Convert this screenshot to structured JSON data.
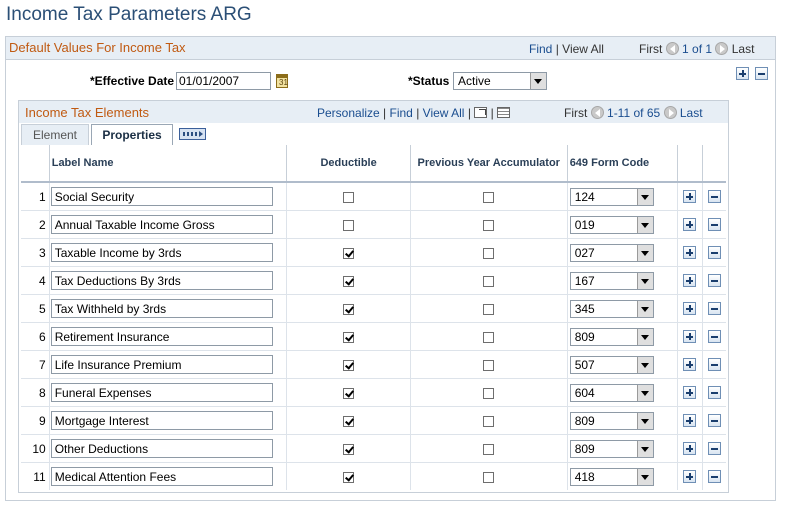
{
  "page": {
    "title": "Income Tax Parameters ARG"
  },
  "outer": {
    "title": "Default Values For Income Tax",
    "nav": {
      "find": "Find",
      "sep": "|",
      "view_all": "View All",
      "first": "First",
      "range": "1 of 1",
      "last": "Last"
    },
    "effective_date_label": "*Effective Date",
    "effective_date_value": "01/01/2007",
    "calendar_icon_text": "31",
    "status_label": "*Status",
    "status_value": "Active"
  },
  "inner": {
    "title": "Income Tax Elements",
    "nav": {
      "personalize": "Personalize",
      "sep": "|",
      "find": "Find",
      "view_all": "View All",
      "first": "First",
      "range": "1-11 of 65",
      "last": "Last"
    },
    "tabs": [
      {
        "label": "Element"
      },
      {
        "label": "Properties"
      }
    ],
    "columns": {
      "label_name": "Label Name",
      "deductible": "Deductible",
      "prev_year": "Previous Year Accumulator",
      "form_code": "649 Form Code"
    },
    "rows": [
      {
        "num": "1",
        "label": "Social Security",
        "deductible": false,
        "prev": false,
        "code": "124"
      },
      {
        "num": "2",
        "label": "Annual Taxable Income Gross",
        "deductible": false,
        "prev": false,
        "code": "019"
      },
      {
        "num": "3",
        "label": "Taxable Income by 3rds",
        "deductible": true,
        "prev": false,
        "code": "027"
      },
      {
        "num": "4",
        "label": "Tax Deductions By 3rds",
        "deductible": true,
        "prev": false,
        "code": "167"
      },
      {
        "num": "5",
        "label": "Tax Withheld by 3rds",
        "deductible": true,
        "prev": false,
        "code": "345"
      },
      {
        "num": "6",
        "label": "Retirement Insurance",
        "deductible": true,
        "prev": false,
        "code": "809"
      },
      {
        "num": "7",
        "label": "Life Insurance Premium",
        "deductible": true,
        "prev": false,
        "code": "507"
      },
      {
        "num": "8",
        "label": "Funeral Expenses",
        "deductible": true,
        "prev": false,
        "code": "604"
      },
      {
        "num": "9",
        "label": "Mortgage Interest",
        "deductible": true,
        "prev": false,
        "code": "809"
      },
      {
        "num": "10",
        "label": "Other Deductions",
        "deductible": true,
        "prev": false,
        "code": "809"
      },
      {
        "num": "11",
        "label": "Medical Attention Fees",
        "deductible": true,
        "prev": false,
        "code": "418"
      }
    ]
  },
  "colors": {
    "title": "#2b4f76",
    "section_title": "#c05a12",
    "link": "#1a4d8f",
    "header_bg": "#e7eef5"
  }
}
